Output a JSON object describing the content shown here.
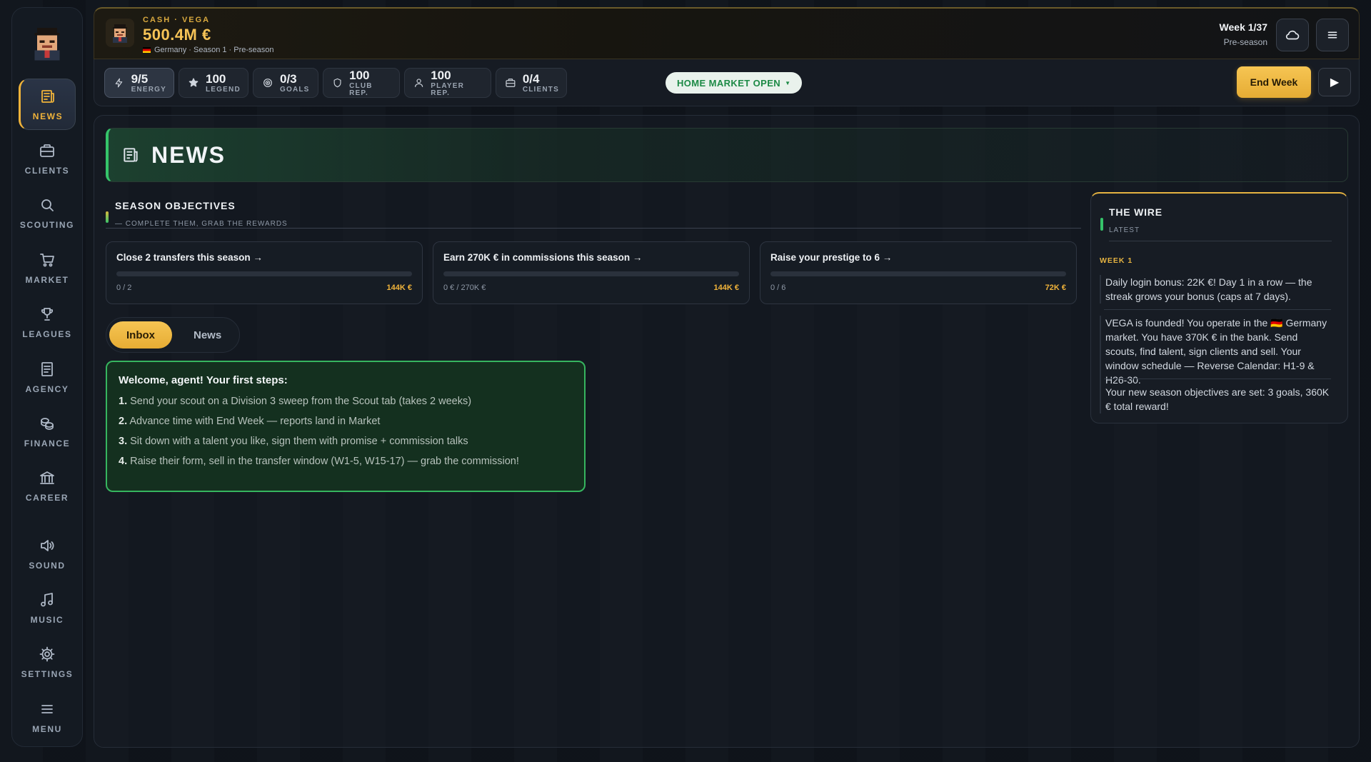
{
  "sidebar": {
    "items": [
      {
        "label": "NEWS",
        "icon": "newspaper-icon"
      },
      {
        "label": "CLIENTS",
        "icon": "briefcase-icon"
      },
      {
        "label": "SCOUTING",
        "icon": "search-icon"
      },
      {
        "label": "MARKET",
        "icon": "cart-icon"
      },
      {
        "label": "LEAGUES",
        "icon": "trophy-icon"
      },
      {
        "label": "AGENCY",
        "icon": "document-icon"
      },
      {
        "label": "FINANCE",
        "icon": "coins-icon"
      },
      {
        "label": "CAREER",
        "icon": "bank-icon"
      }
    ],
    "bottom": [
      {
        "label": "SOUND",
        "icon": "speaker-icon"
      },
      {
        "label": "MUSIC",
        "icon": "music-note-icon"
      },
      {
        "label": "SETTINGS",
        "icon": "gear-icon"
      },
      {
        "label": "MENU",
        "icon": "hamburger-icon"
      }
    ]
  },
  "header": {
    "cash_label": "CASH · VEGA",
    "cash_value": "500.4M €",
    "sub": "Germany · Season 1 · Pre-season",
    "week": "Week 1/37",
    "week_sub": "Pre-season"
  },
  "stats": [
    {
      "value": "9/5",
      "label": "ENERGY",
      "icon": "lightning-icon"
    },
    {
      "value": "100",
      "label": "LEGEND",
      "icon": "star-icon"
    },
    {
      "value": "0/3",
      "label": "GOALS",
      "icon": "target-icon"
    },
    {
      "value": "100",
      "label": "CLUB REP.",
      "icon": "shield-icon"
    },
    {
      "value": "100",
      "label": "PLAYER REP.",
      "icon": "person-icon"
    },
    {
      "value": "0/4",
      "label": "CLIENTS",
      "icon": "briefcase-icon"
    }
  ],
  "market_status": "HOME MARKET OPEN",
  "end_week": "End Week",
  "page_title": "NEWS",
  "objectives": {
    "title": "SEASON OBJECTIVES",
    "subtitle": "— COMPLETE THEM, GRAB THE REWARDS",
    "items": [
      {
        "title": "Close 2 transfers this season →",
        "progress": "0 / 2",
        "reward": "144K €",
        "fraction": 0
      },
      {
        "title": "Earn 270K € in commissions this season →",
        "progress": "0 € / 270K €",
        "reward": "144K €",
        "fraction": 0
      },
      {
        "title": "Raise your prestige to 6 →",
        "progress": "0 / 6",
        "reward": "72K €",
        "fraction": 0
      }
    ]
  },
  "tabs": [
    {
      "label": "Inbox",
      "active": true
    },
    {
      "label": "News",
      "active": false
    }
  ],
  "welcome": {
    "title": "Welcome, agent! Your first steps:",
    "steps": [
      {
        "num": "1.",
        "text": "Send your scout on a Division 3 sweep from the Scout tab (takes 2 weeks)"
      },
      {
        "num": "2.",
        "text": "Advance time with End Week — reports land in Market"
      },
      {
        "num": "3.",
        "text": "Sit down with a talent you like, sign them with promise + commission talks"
      },
      {
        "num": "4.",
        "text": "Raise their form, sell in the transfer window (W1-5, W15-17) — grab the commission!"
      }
    ]
  },
  "wire": {
    "title": "THE WIRE",
    "subtitle": "LATEST",
    "week": "WEEK 1",
    "items": [
      "Daily login bonus: 22K €! Day 1 in a row — the streak grows your bonus (caps at 7 days).",
      "VEGA is founded! You operate in the 🇩🇪 Germany market. You have 370K € in the bank. Send scouts, find talent, sign clients and sell. Your window schedule — Reverse Calendar: H1-9 & H26-30.",
      "Your new season objectives are set: 3 goals, 360K € total reward!"
    ]
  },
  "colors": {
    "accent": "#f0b33a",
    "green": "#36c36a",
    "background": "#0f141b"
  }
}
